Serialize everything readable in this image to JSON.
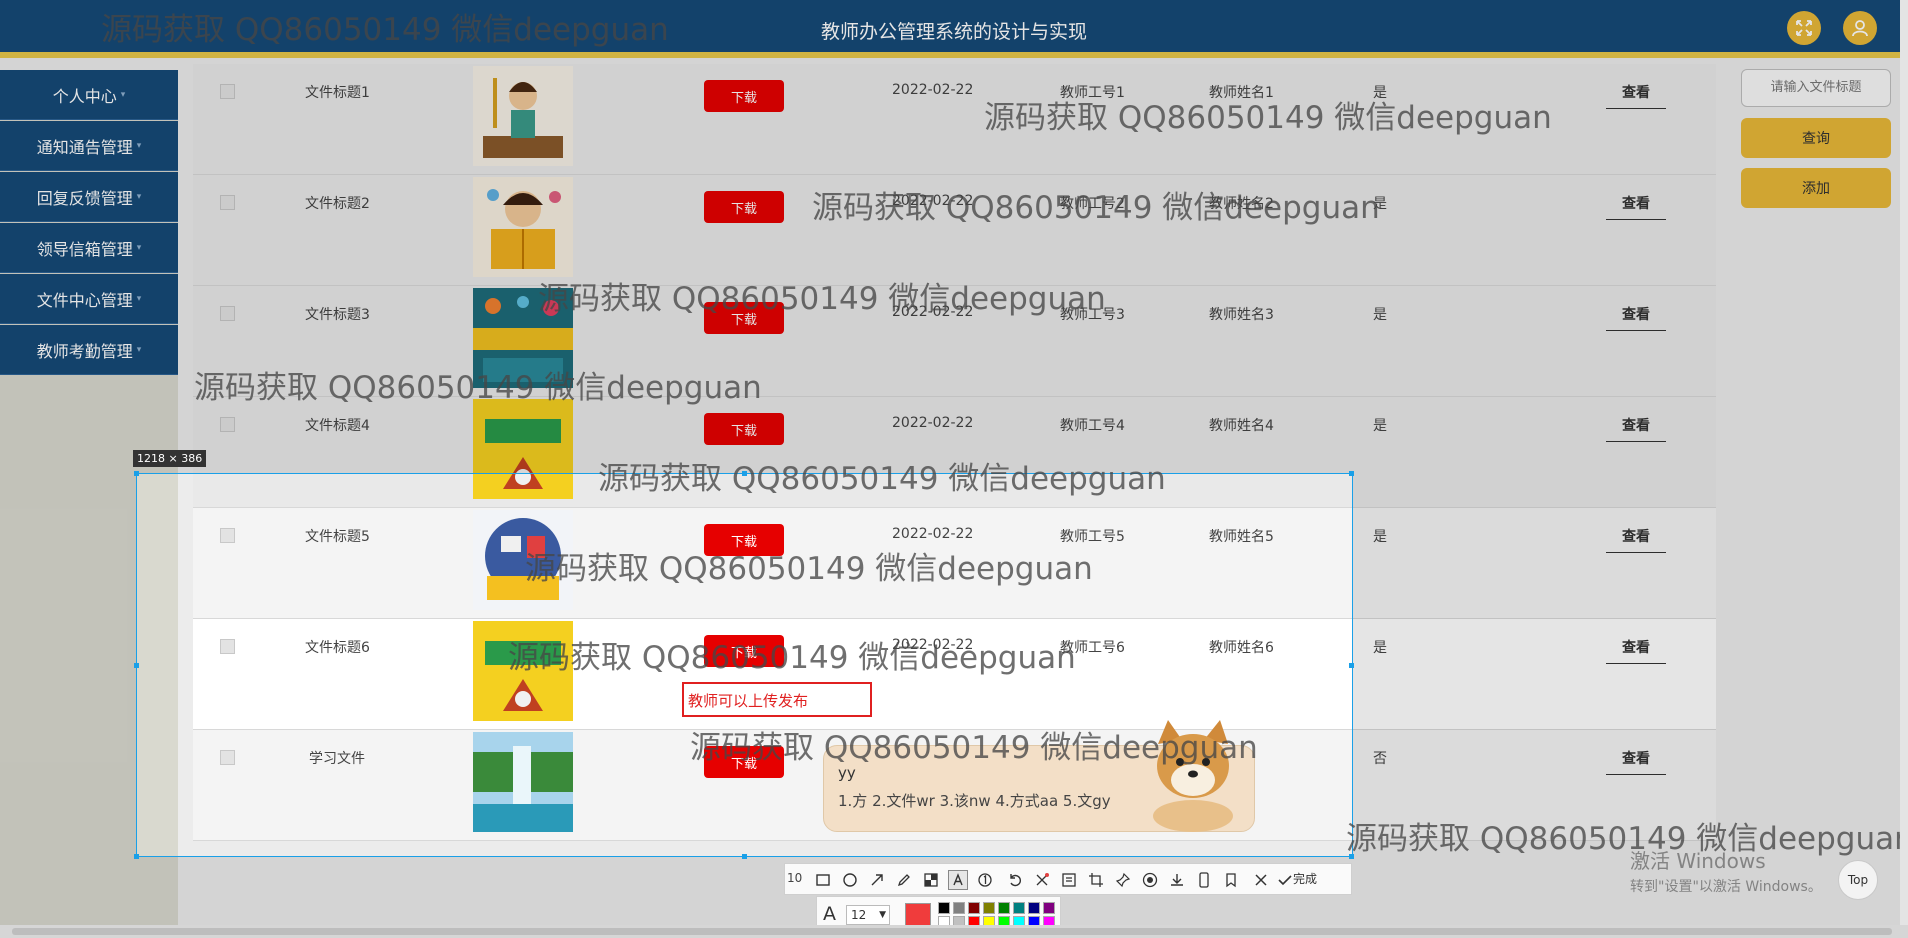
{
  "header": {
    "title": "教师办公管理系统的设计与实现"
  },
  "sidebar": {
    "items": [
      {
        "label": "个人中心"
      },
      {
        "label": "通知通告管理"
      },
      {
        "label": "回复反馈管理"
      },
      {
        "label": "领导信箱管理"
      },
      {
        "label": "文件中心管理"
      },
      {
        "label": "教师考勤管理"
      }
    ]
  },
  "rows": [
    {
      "title": "文件标题1",
      "download": "下载",
      "date": "2022-02-22",
      "teacher_no": "教师工号1",
      "teacher_name": "教师姓名1",
      "flag": "是",
      "view": "查看"
    },
    {
      "title": "文件标题2",
      "download": "下载",
      "date": "2022-02-22",
      "teacher_no": "教师工号2",
      "teacher_name": "教师姓名2",
      "flag": "是",
      "view": "查看"
    },
    {
      "title": "文件标题3",
      "download": "下载",
      "date": "2022-02-22",
      "teacher_no": "教师工号3",
      "teacher_name": "教师姓名3",
      "flag": "是",
      "view": "查看"
    },
    {
      "title": "文件标题4",
      "download": "下载",
      "date": "2022-02-22",
      "teacher_no": "教师工号4",
      "teacher_name": "教师姓名4",
      "flag": "是",
      "view": "查看"
    },
    {
      "title": "文件标题5",
      "download": "下载",
      "date": "2022-02-22",
      "teacher_no": "教师工号5",
      "teacher_name": "教师姓名5",
      "flag": "是",
      "view": "查看"
    },
    {
      "title": "文件标题6",
      "download": "下载",
      "date": "2022-02-22",
      "teacher_no": "教师工号6",
      "teacher_name": "教师姓名6",
      "flag": "是",
      "view": "查看"
    },
    {
      "title": "学习文件",
      "download": "下载",
      "date": "",
      "teacher_no": "",
      "teacher_name": "",
      "flag": "否",
      "view": "查看"
    }
  ],
  "panel": {
    "search_placeholder": "请输入文件标题",
    "query": "查询",
    "add": "添加"
  },
  "screenshot": {
    "selection_size": "1218 × 386",
    "annotation_text": "教师可以上传发布",
    "size_value": "10",
    "done_label": "完成",
    "font_size": "12",
    "colors": [
      "#000000",
      "#808080",
      "#800000",
      "#808000",
      "#008000",
      "#008080",
      "#000080",
      "#800080",
      "#ffffff",
      "#c0c0c0",
      "#ff0000",
      "#ffff00",
      "#00ff00",
      "#00ffff",
      "#0000ff",
      "#ff00ff"
    ],
    "current_color": "#f03c3c"
  },
  "ime": {
    "composition": "yy",
    "candidates": "1.方  2.文件wr  3.该nw  4.方式aa  5.文gy"
  },
  "watermark": "源码获取 QQ86050149 微信deepguan",
  "activation": {
    "line1": "激活 Windows",
    "line2": "转到\"设置\"以激活 Windows。"
  },
  "top_button": "Top"
}
